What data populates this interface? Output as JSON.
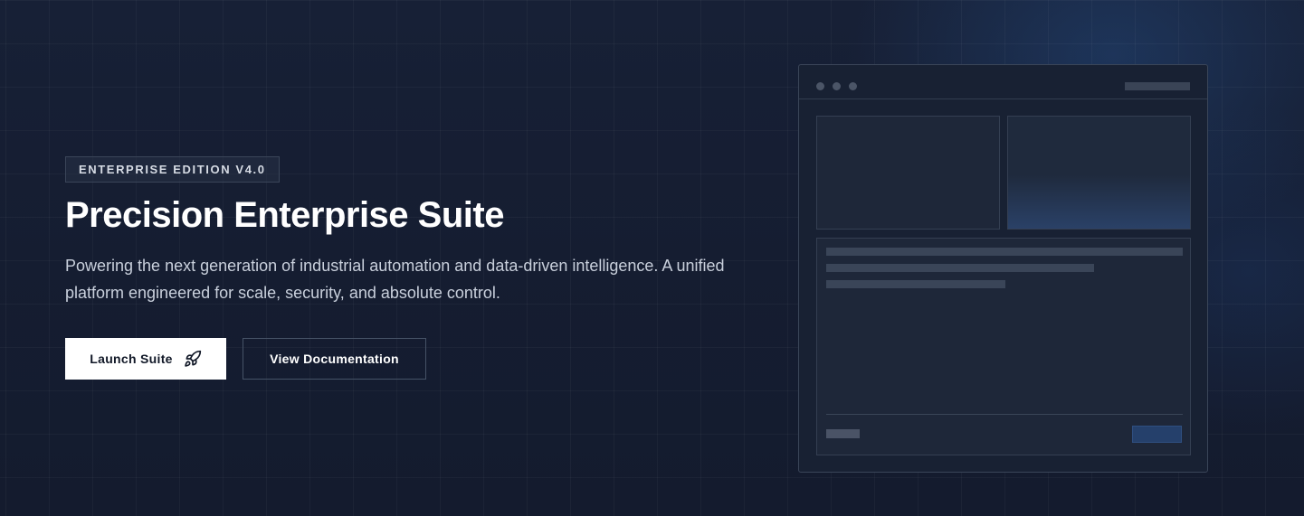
{
  "hero": {
    "badge": "ENTERPRISE EDITION V4.0",
    "title": "Precision Enterprise Suite",
    "description": "Powering the next generation of industrial automation and data-driven intelligence. A unified platform engineered for scale, security, and absolute control.",
    "primary_button": {
      "label": "Launch Suite",
      "icon": "rocket-icon"
    },
    "secondary_button": {
      "label": "View Documentation"
    }
  },
  "colors": {
    "background": "#141c2e",
    "primary_button_bg": "#ffffff",
    "accent_blue": "#25406b"
  }
}
